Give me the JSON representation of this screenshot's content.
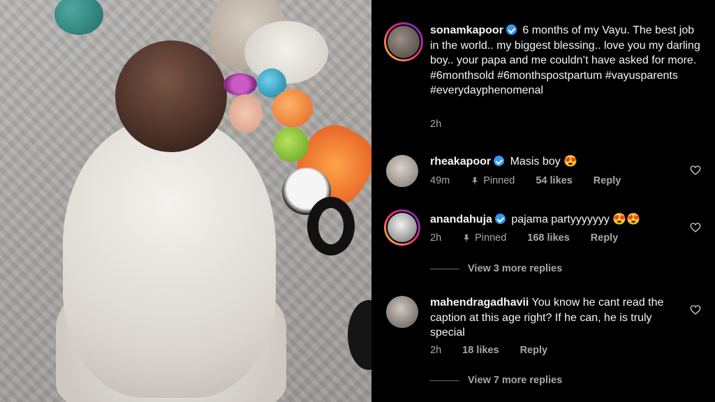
{
  "caption": {
    "username": "sonamkapoor",
    "text": "6 months of my Vayu. The best job in the world.. my biggest blessing.. love you my darling boy.. your papa and me couldn’t have asked for more. #6monthsold #6monthspostpartum #vayusparents #everydayphenomenal",
    "time": "2h"
  },
  "comments": [
    {
      "username": "rheakapoor",
      "verified": true,
      "text": "Masis boy 😍",
      "time": "49m",
      "pinned_label": "Pinned",
      "likes": "54 likes",
      "reply_label": "Reply"
    },
    {
      "username": "anandahuja",
      "verified": true,
      "text": "pajama partyyyyyyy 😍😍",
      "time": "2h",
      "pinned_label": "Pinned",
      "likes": "168 likes",
      "reply_label": "Reply",
      "view_replies": "View 3 more replies"
    },
    {
      "username": "mahendragadhavii",
      "verified": false,
      "text": "You know he cant read the caption at this age right? If he can, he is truly special",
      "time": "2h",
      "likes": "18 likes",
      "reply_label": "Reply",
      "view_replies": "View 7 more replies"
    }
  ],
  "colors": {
    "background": "#000000",
    "text": "#f5f5f5",
    "muted": "#a8a8a8",
    "verified": "#3897f0"
  }
}
